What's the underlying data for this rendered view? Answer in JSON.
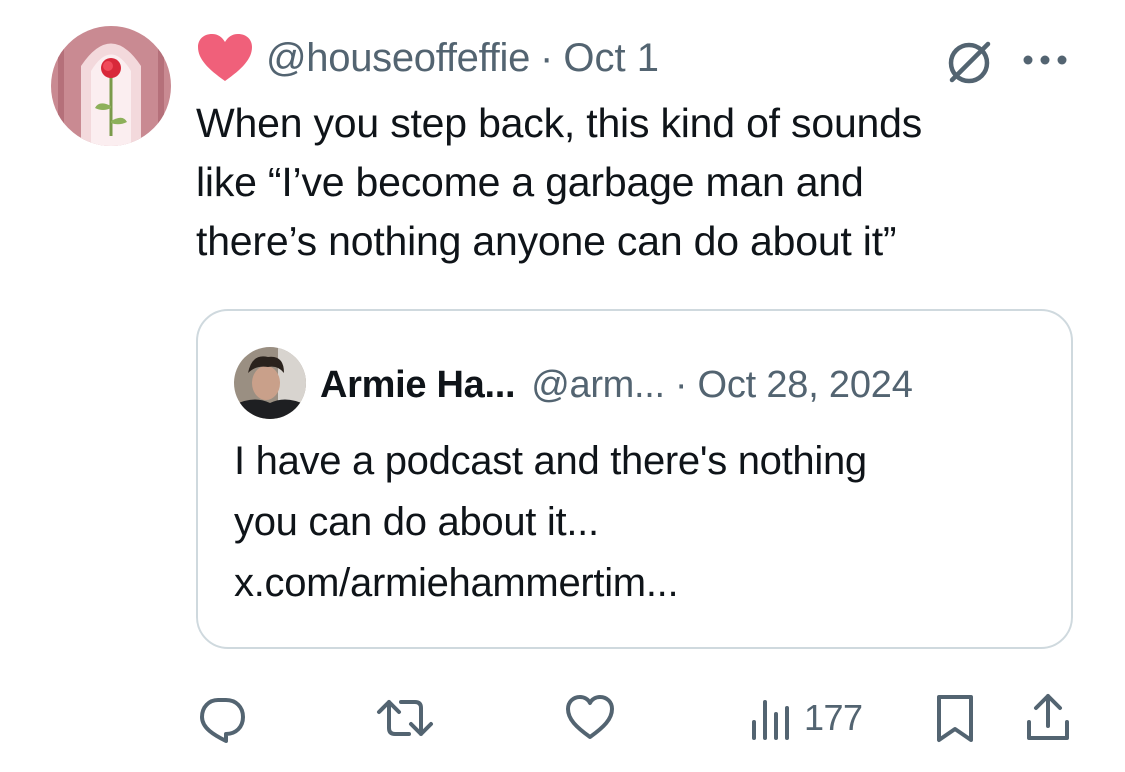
{
  "tweet": {
    "handle": "@houseoffeffie",
    "separator": "·",
    "date": "Oct 1",
    "text": "When you step back, this kind of sounds\nlike “I’ve become a garbage man and\nthere’s nothing anyone can do about it”"
  },
  "quoted_tweet": {
    "name": "Armie Ha...",
    "handle": "@arm...",
    "separator": "·",
    "date": "Oct 28, 2024",
    "text": "I have a podcast and there's nothing\nyou can do about it...\nx.com/armiehammertim..."
  },
  "actions": {
    "views_count": "177"
  },
  "colors": {
    "text_primary": "#0f1419",
    "text_secondary": "#536471",
    "border": "#cfd9de",
    "heart_badge": "#f0607a"
  },
  "icons": {
    "avatar": "rose-stained-glass-avatar",
    "badge": "heart-icon",
    "top_right": [
      "no-entry-icon",
      "more-icon"
    ],
    "action_bar": [
      "reply-icon",
      "retweet-icon",
      "like-icon",
      "views-icon",
      "bookmark-icon",
      "share-icon"
    ]
  }
}
